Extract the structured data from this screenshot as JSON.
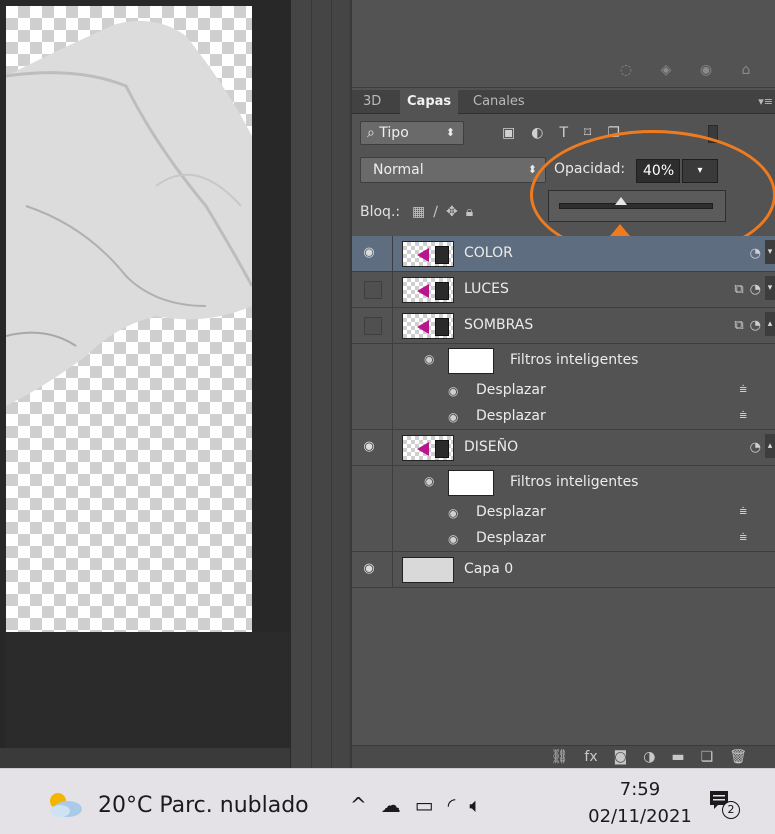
{
  "panel_tabs": [
    {
      "label": "3D"
    },
    {
      "label": "Capas"
    },
    {
      "label": "Canales"
    }
  ],
  "filter": {
    "kind_label": "Tipo"
  },
  "blend": {
    "mode": "Normal",
    "opacity_label": "Opacidad:",
    "opacity_value": "40%",
    "opacity_fraction": 0.4
  },
  "lock": {
    "label": "Bloq.:"
  },
  "layers": [
    {
      "name": "COLOR",
      "visible": true,
      "selected": true
    },
    {
      "name": "LUCES",
      "visible": false
    },
    {
      "name": "SOMBRAS",
      "visible": false,
      "smart_filters": {
        "label": "Filtros inteligentes",
        "filters": [
          "Desplazar",
          "Desplazar"
        ]
      }
    },
    {
      "name": "DISEÑO",
      "visible": true,
      "smart_filters": {
        "label": "Filtros inteligentes",
        "filters": [
          "Desplazar",
          "Desplazar"
        ]
      }
    },
    {
      "name": "Capa 0",
      "visible": true
    }
  ],
  "bottom_icons": [
    "link-icon",
    "fx-icon",
    "mask-icon",
    "adjustment-icon",
    "folder-icon",
    "new-layer-icon",
    "trash-icon"
  ],
  "taskbar": {
    "weather": "20°C  Parc. nublado",
    "time": "7:59",
    "date": "02/11/2021",
    "notifications": "2"
  },
  "colors": {
    "accent_annotation": "#f07b1e",
    "selected_row": "#5f6d80",
    "panel_bg": "#535353"
  }
}
